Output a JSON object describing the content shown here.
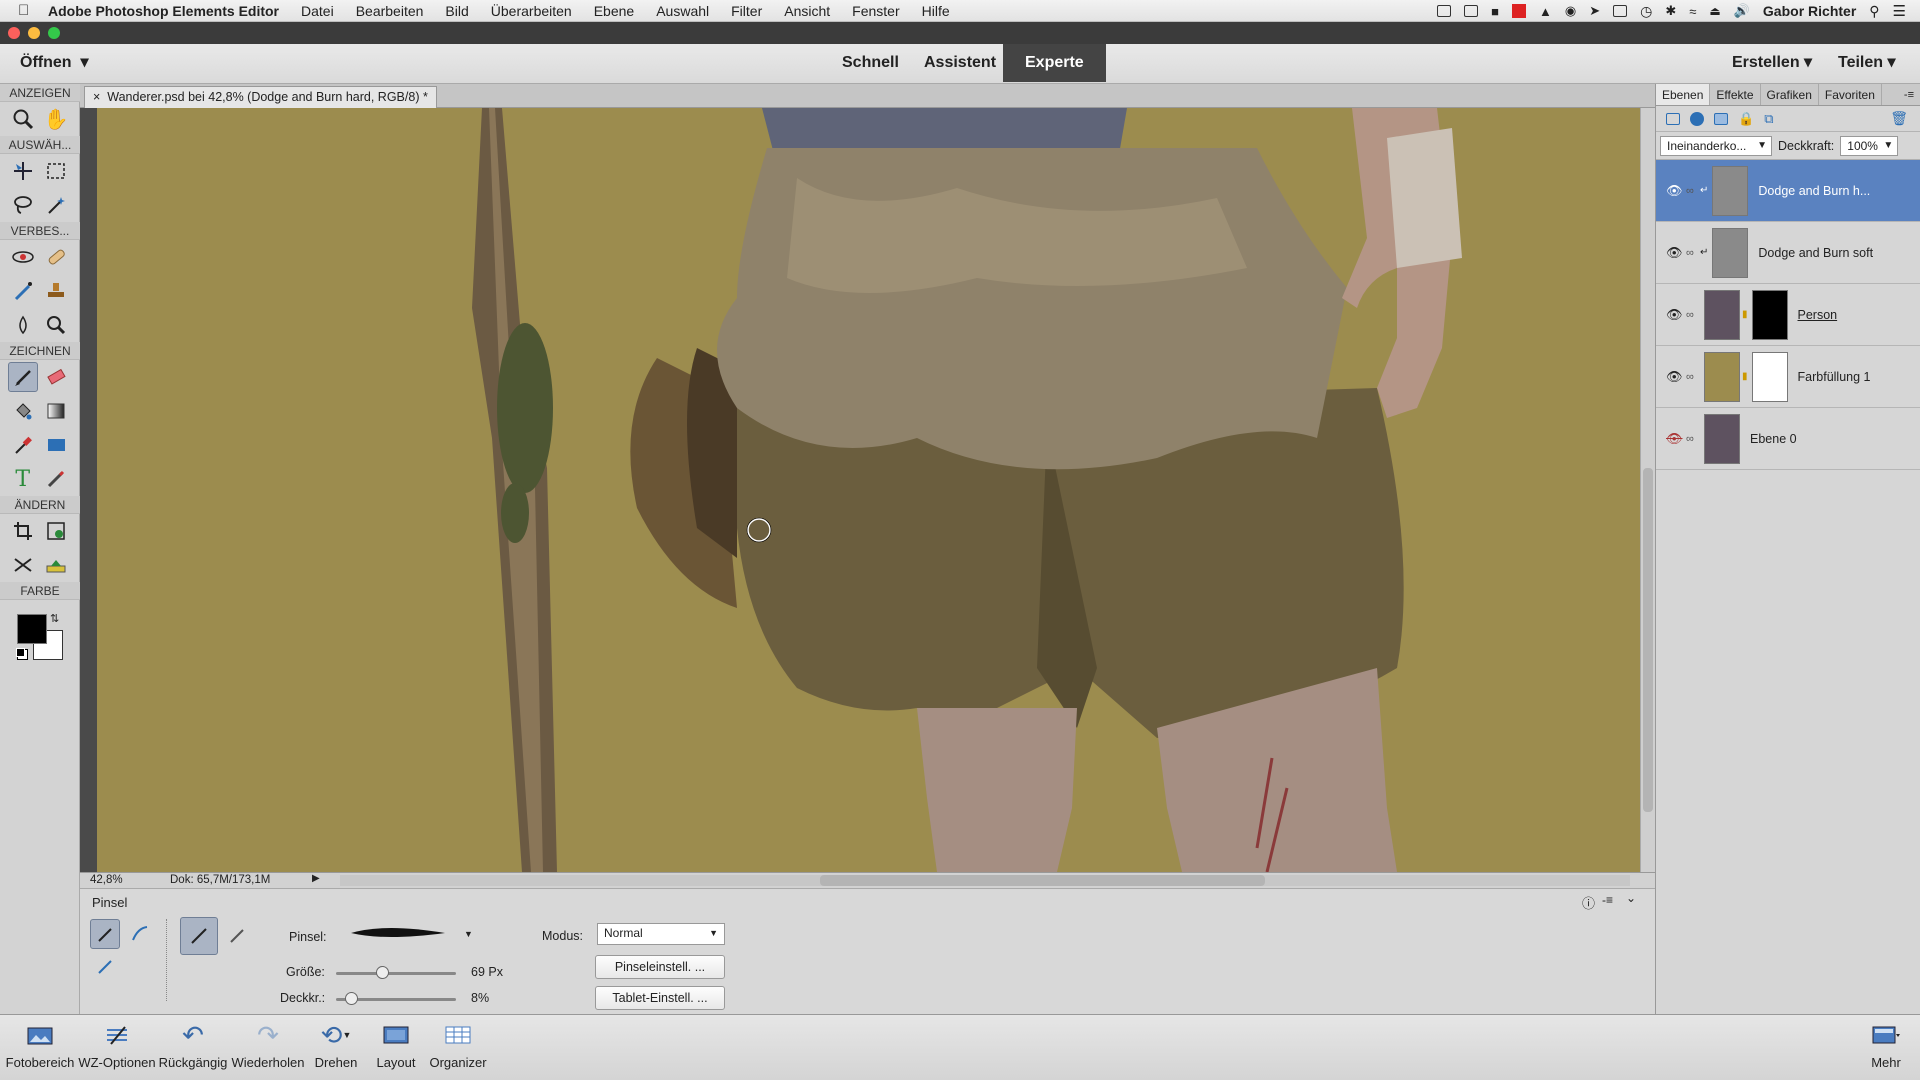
{
  "menubar": {
    "app": "Adobe Photoshop Elements Editor",
    "items": [
      "Datei",
      "Bearbeiten",
      "Bild",
      "Überarbeiten",
      "Ebene",
      "Auswahl",
      "Filter",
      "Ansicht",
      "Fenster",
      "Hilfe"
    ],
    "user": "Gabor Richter"
  },
  "modebar": {
    "open": "Öffnen",
    "modes": [
      "Schnell",
      "Assistent",
      "Experte"
    ],
    "active_mode": "Experte",
    "create": "Erstellen",
    "share": "Teilen"
  },
  "toolbox": {
    "sections": [
      "ANZEIGEN",
      "AUSWÄH...",
      "VERBES...",
      "ZEICHNEN",
      "ÄNDERN",
      "FARBE"
    ],
    "foreground_color": "#000000",
    "background_color": "#ffffff"
  },
  "document": {
    "tab_title": "Wanderer.psd bei 42,8% (Dodge and Burn hard, RGB/8) *",
    "background_color": "#9c8c4e"
  },
  "status": {
    "zoom": "42,8%",
    "doc": "Dok: 65,7M/173,1M"
  },
  "layers_panel": {
    "tabs": [
      "Ebenen",
      "Effekte",
      "Grafiken",
      "Favoriten"
    ],
    "active_tab": "Ebenen",
    "blend_mode": "Ineinanderko...",
    "opacity_label": "Deckkraft:",
    "opacity_value": "100%",
    "layers": [
      {
        "name": "Dodge and Burn h...",
        "visible": true,
        "selected": true
      },
      {
        "name": "Dodge and Burn soft",
        "visible": true,
        "selected": false
      },
      {
        "name": "Person",
        "visible": true,
        "selected": false
      },
      {
        "name": "Farbfüllung 1",
        "visible": true,
        "selected": false
      },
      {
        "name": "Ebene 0",
        "visible": false,
        "selected": false
      }
    ]
  },
  "options": {
    "tool_name": "Pinsel",
    "brush_label": "Pinsel:",
    "size_label": "Größe:",
    "size_value": "69 Px",
    "size_fraction": 0.37,
    "opacity_label": "Deckkr.:",
    "opacity_value": "8%",
    "opacity_fraction": 0.08,
    "mode_label": "Modus:",
    "mode_value": "Normal",
    "brush_settings": "Pinseleinstell. ...",
    "tablet_settings": "Tablet-Einstell. ..."
  },
  "bottombar": {
    "items": [
      "Fotobereich",
      "WZ-Optionen",
      "Rückgängig",
      "Wiederholen",
      "Drehen",
      "Layout",
      "Organizer"
    ],
    "more": "Mehr"
  }
}
